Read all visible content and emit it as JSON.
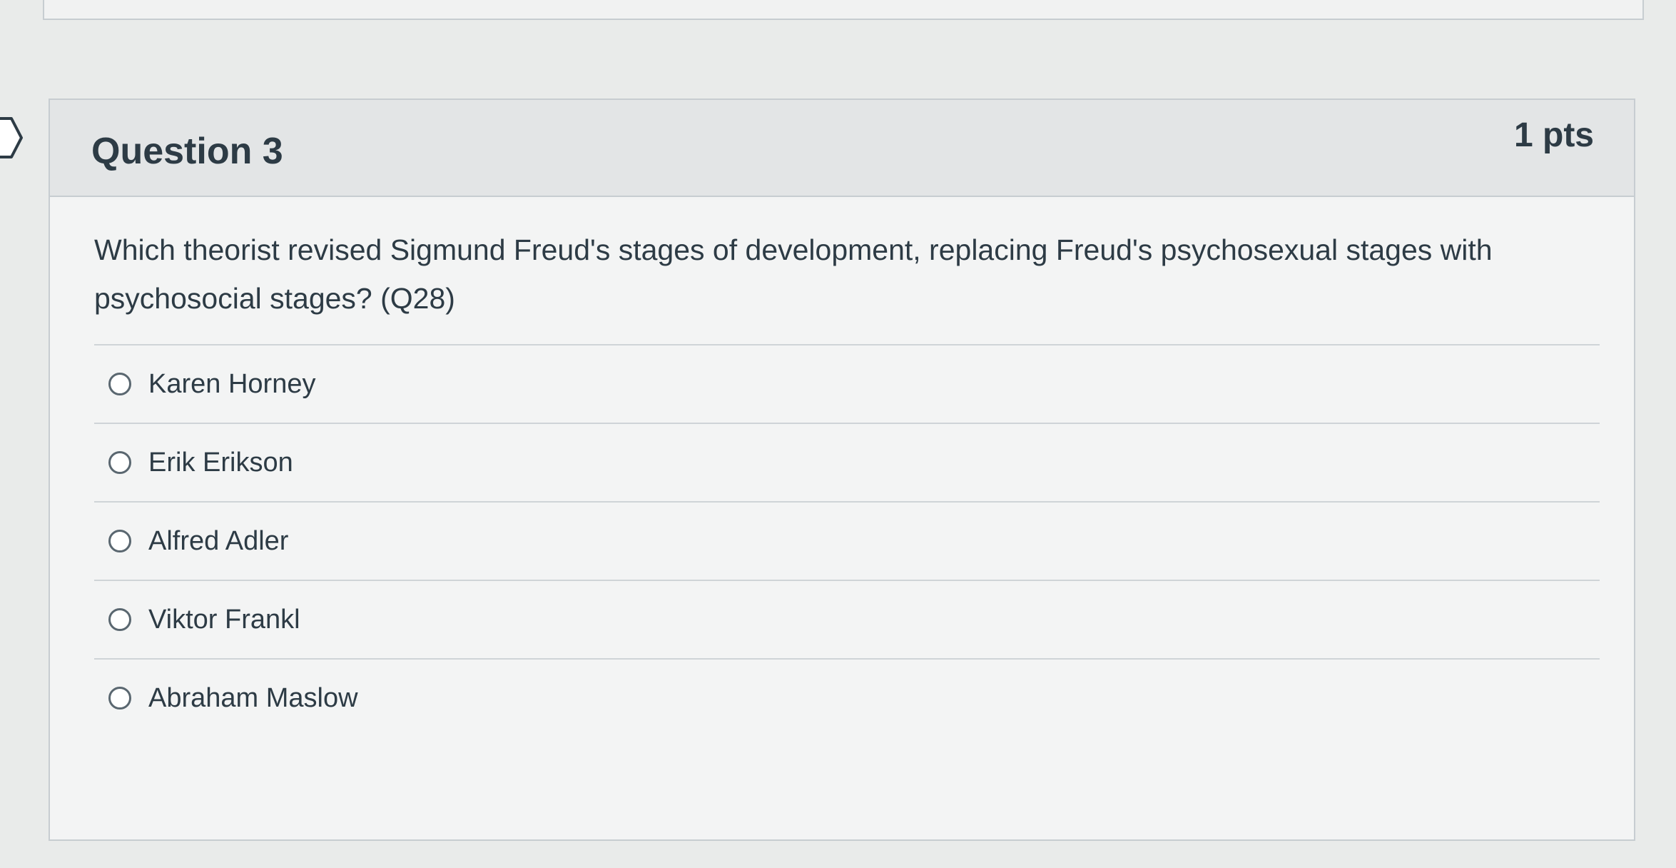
{
  "question": {
    "title": "Question 3",
    "points": "1 pts",
    "text": "Which theorist revised Sigmund Freud's stages of development, replacing Freud's psychosexual stages with psychosocial stages? (Q28)",
    "answers": [
      {
        "label": "Karen Horney"
      },
      {
        "label": "Erik Erikson"
      },
      {
        "label": "Alfred Adler"
      },
      {
        "label": "Viktor Frankl"
      },
      {
        "label": "Abraham Maslow"
      }
    ]
  },
  "icons": {
    "flag": "bookmark-flag-icon",
    "radio": "radio-unselected-icon"
  },
  "colors": {
    "text": "#2d3b45",
    "header_bg": "#e3e5e6",
    "border": "#c7cdd1"
  }
}
